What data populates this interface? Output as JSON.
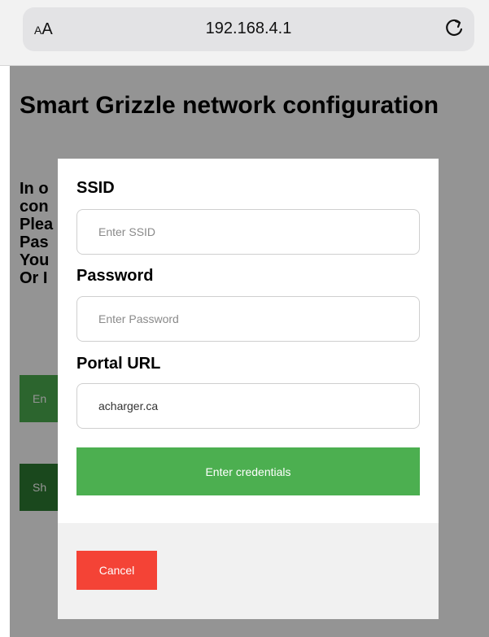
{
  "browser": {
    "text_size_label": "AA",
    "url": "192.168.4.1",
    "reload_icon": "reload-icon"
  },
  "page": {
    "title": "Smart Grizzle network configuration",
    "body_lines": [
      "In o",
      "con",
      "Plea",
      "Pas",
      "You",
      "Or I"
    ],
    "enter_button_label": "En",
    "show_button_label": "Sh",
    "colors": {
      "enter": "#4caf50",
      "show": "#2e7d32"
    }
  },
  "modal": {
    "ssid": {
      "label": "SSID",
      "placeholder": "Enter SSID",
      "value": ""
    },
    "password": {
      "label": "Password",
      "placeholder": "Enter Password",
      "value": ""
    },
    "portal_url": {
      "label": "Portal URL",
      "placeholder": "",
      "value": "acharger.ca"
    },
    "submit_label": "Enter credentials",
    "cancel_label": "Cancel",
    "colors": {
      "submit": "#4caf50",
      "cancel": "#f44336"
    }
  }
}
